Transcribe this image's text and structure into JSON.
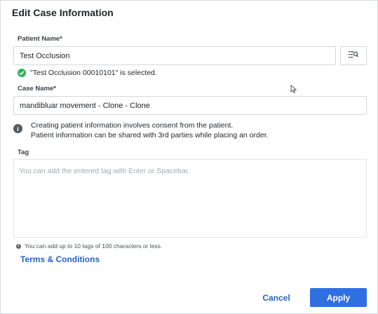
{
  "dialog": {
    "title": "Edit Case Information"
  },
  "patient": {
    "label": "Patient Name*",
    "value": "Test Occlusion",
    "search_icon": "list-search-icon",
    "selected_text": "\"Test Occlusion  00010101\" is selected."
  },
  "case": {
    "label": "Case Name*",
    "value": "mandibluar movement - Clone - Clone"
  },
  "notice": {
    "line1": "Creating patient information involves consent from the patient.",
    "line2": "Patient information can be shared with 3rd parties while placing an order."
  },
  "tag": {
    "label": "Tag",
    "placeholder": "You can add the entered tag with Enter or Spacebar.",
    "hint": "You can add up to 10 tags of 100 characters or less."
  },
  "links": {
    "terms": "Terms & Conditions"
  },
  "actions": {
    "cancel": "Cancel",
    "apply": "Apply"
  },
  "colors": {
    "accent": "#2f6fe0",
    "link": "#2563c9",
    "success": "#2fb35a"
  }
}
